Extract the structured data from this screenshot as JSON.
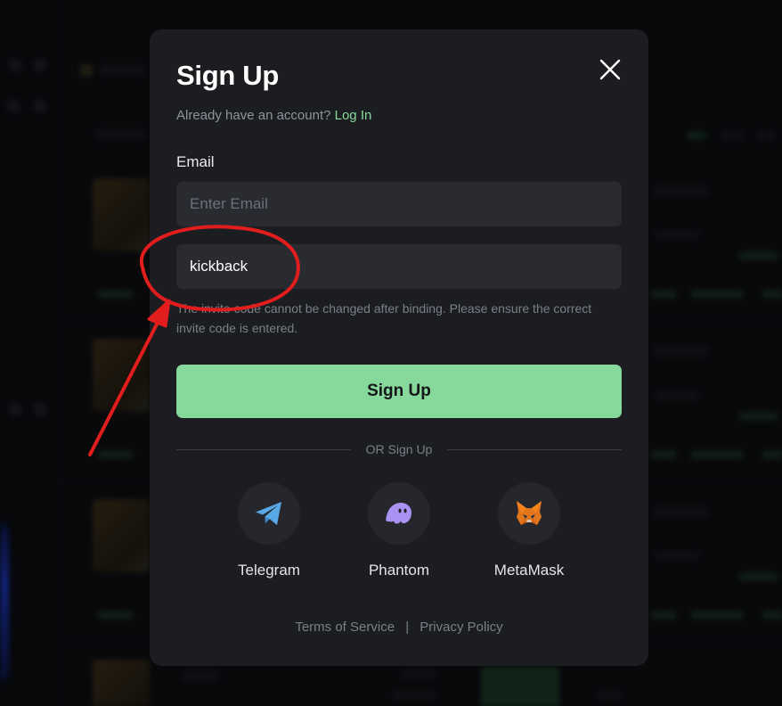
{
  "modal": {
    "title": "Sign Up",
    "already_text": "Already have an account?",
    "login_link": "Log In",
    "email_label": "Email",
    "email_placeholder": "Enter Email",
    "email_value": "",
    "invite_value": "kickback",
    "invite_note": "The invite code cannot be changed after binding. Please ensure the correct invite code is entered.",
    "signup_button": "Sign Up",
    "divider_text": "OR Sign Up",
    "social": [
      {
        "label": "Telegram",
        "icon": "telegram-icon"
      },
      {
        "label": "Phantom",
        "icon": "phantom-icon"
      },
      {
        "label": "MetaMask",
        "icon": "metamask-icon"
      }
    ],
    "footer": {
      "terms": "Terms of Service",
      "separator": "|",
      "privacy": "Privacy Policy"
    }
  },
  "colors": {
    "accent": "#86d99b",
    "modal_bg": "#1c1d21",
    "input_bg": "#2a2b30",
    "annotation_red": "#e11d1d"
  }
}
